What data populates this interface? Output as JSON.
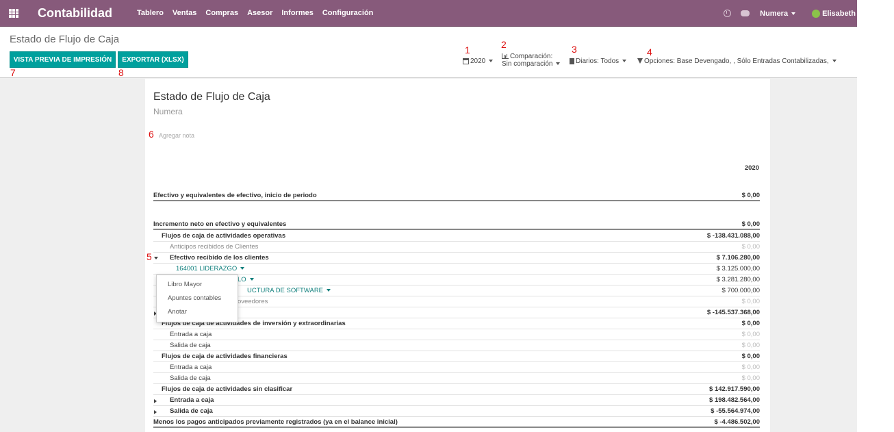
{
  "navbar": {
    "brand": "Contabilidad",
    "menu": [
      "Tablero",
      "Ventas",
      "Compras",
      "Asesor",
      "Informes",
      "Configuración"
    ],
    "company": "Numera",
    "user": "Elisabeth"
  },
  "control_panel": {
    "title": "Estado de Flujo de Caja",
    "print_button": "VISTA PREVIA DE IMPRESIÓN",
    "export_button": "EXPORTAR (XLSX)",
    "filters": {
      "period": "2020",
      "comparison_label": "Comparación:",
      "comparison_value": "Sin comparación",
      "journals": "Diarios: Todos",
      "options": "Opciones: Base Devengado, , Sólo Entradas Contabilizadas,"
    }
  },
  "annotations": [
    "1",
    "2",
    "3",
    "4",
    "5",
    "6",
    "7",
    "8"
  ],
  "report": {
    "title": "Estado de Flujo de Caja",
    "company": "Numera",
    "add_note": "Agregar nota",
    "column_header": "2020",
    "rows": [
      {
        "label": "Efectivo y equivalentes de efectivo, inicio de periodo",
        "value": "$ 0,00"
      },
      {
        "label": "Incremento neto en efectivo y equivalentes",
        "value": "$ 0,00"
      },
      {
        "label": "Flujos de caja de actividades operativas",
        "value": "$ -138.431.088,00"
      },
      {
        "label": "Anticipos recibidos de Clientes",
        "value": "$ 0,00"
      },
      {
        "label": "Efectivo recibido de los clientes",
        "value": "$ 7.106.280,00"
      },
      {
        "label": "164001 LIDERAZGO",
        "value": "$ 3.125.000,00"
      },
      {
        "label": "LO",
        "value": "$ 3.281.280,00"
      },
      {
        "label": "UCTURA DE SOFTWARE",
        "value": "$ 700.000,00"
      },
      {
        "label": "oveedores",
        "value": "$ 0,00"
      },
      {
        "label": "",
        "value": "$ -145.537.368,00"
      },
      {
        "label": "Flujos de caja de actividades de inversión y extraordinarias",
        "value": "$ 0,00"
      },
      {
        "label": "Entrada a caja",
        "value": "$ 0,00"
      },
      {
        "label": "Salida de caja",
        "value": "$ 0,00"
      },
      {
        "label": "Flujos de caja de actividades financieras",
        "value": "$ 0,00"
      },
      {
        "label": "Entrada a caja",
        "value": "$ 0,00"
      },
      {
        "label": "Salida de caja",
        "value": "$ 0,00"
      },
      {
        "label": "Flujos de caja de actividades sin clasificar",
        "value": "$ 142.917.590,00"
      },
      {
        "label": "Entrada a caja",
        "value": "$ 198.482.564,00"
      },
      {
        "label": "Salida de caja",
        "value": "$ -55.564.974,00"
      },
      {
        "label": "Menos los pagos anticipados previamente registrados (ya en el balance inicial)",
        "value": "$ -4.486.502,00"
      }
    ]
  },
  "popup_menu": [
    "Libro Mayor",
    "Apuntes contables",
    "Anotar"
  ]
}
